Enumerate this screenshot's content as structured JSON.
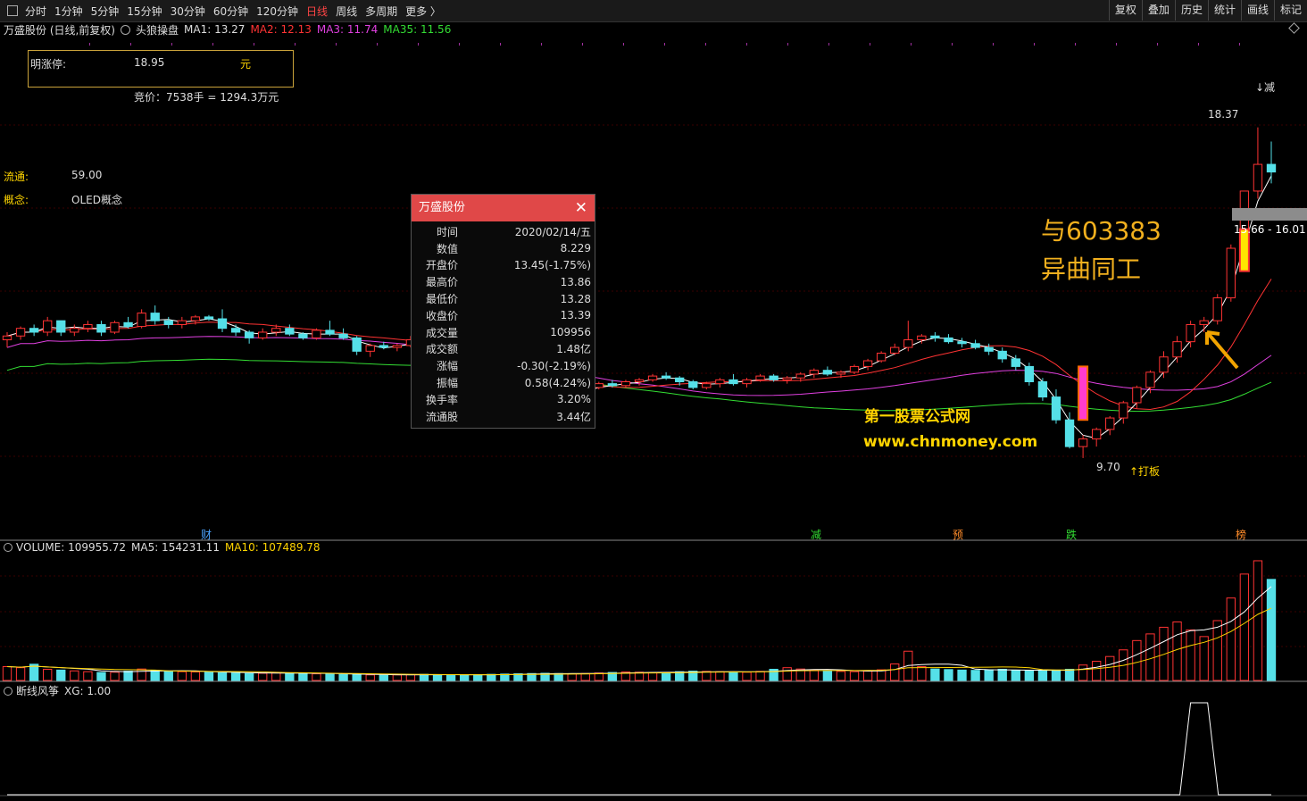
{
  "toolbar": {
    "periods": [
      "分时",
      "1分钟",
      "5分钟",
      "15分钟",
      "30分钟",
      "60分钟",
      "120分钟",
      "日线",
      "周线",
      "多周期",
      "更多 〉"
    ],
    "active_period": "日线",
    "tools": [
      "复权",
      "叠加",
      "历史",
      "统计",
      "画线",
      "标记"
    ]
  },
  "header": {
    "stock": "万盛股份 (日线,前复权)",
    "indicator": "头狼操盘",
    "ma1": "MA1: 13.27",
    "ma2": "MA2: 12.13",
    "ma3": "MA3: 11.74",
    "ma35": "MA35: 11.56",
    "colors": {
      "ma1": "#ffffff",
      "ma2": "#ff3333",
      "ma3": "#e040e0",
      "ma35": "#33dd33"
    }
  },
  "info_box": {
    "label": "明涨停:",
    "value": "18.95",
    "unit": "元"
  },
  "jingjia": "竞价：7538手 = 1294.3万元",
  "side": {
    "liutong_label": "流通:",
    "liutong_value": "59.00",
    "gainian_label": "概念:",
    "gainian_value": "OLED概念"
  },
  "popup": {
    "title": "万盛股份",
    "rows": [
      {
        "k": "时间",
        "v": "2020/02/14/五",
        "c": ""
      },
      {
        "k": "数值",
        "v": "8.229",
        "c": ""
      },
      {
        "k": "开盘价",
        "v": "13.45(-1.75%)",
        "c": "g"
      },
      {
        "k": "最高价",
        "v": "13.86",
        "c": "r"
      },
      {
        "k": "最低价",
        "v": "13.28",
        "c": "g"
      },
      {
        "k": "收盘价",
        "v": "13.39",
        "c": "g"
      },
      {
        "k": "成交量",
        "v": "109956",
        "c": ""
      },
      {
        "k": "成交额",
        "v": "1.48亿",
        "c": ""
      },
      {
        "k": "涨幅",
        "v": "-0.30(-2.19%)",
        "c": "g"
      },
      {
        "k": "振幅",
        "v": "0.58(4.24%)",
        "c": ""
      },
      {
        "k": "换手率",
        "v": "3.20%",
        "c": ""
      },
      {
        "k": "流通股",
        "v": "3.44亿",
        "c": ""
      }
    ]
  },
  "annotation": {
    "line1": "与603383",
    "line2": "异曲同工"
  },
  "watermark": {
    "line1": "第一股票公式网",
    "line2": "www.chnmoney.com"
  },
  "chart_labels": {
    "high": "18.37",
    "low": "9.70",
    "reduce": "↓减",
    "daban": "↑打板",
    "price_range": "15.66 - 16.01"
  },
  "event_markers": [
    "财",
    "减",
    "预",
    "跌",
    "榜"
  ],
  "volume_panel": {
    "vol": "VOLUME: 109955.72",
    "ma5": "MA5: 154231.11",
    "ma10": "MA10: 107489.78"
  },
  "xg_panel": {
    "title": "断线风筝",
    "xg": "XG: 1.00"
  },
  "chart_data": {
    "type": "candlestick",
    "candles": [
      [
        12.8,
        13.0,
        12.6,
        12.9
      ],
      [
        12.9,
        13.15,
        12.8,
        13.1
      ],
      [
        13.1,
        13.2,
        12.9,
        13.0
      ],
      [
        13.0,
        13.4,
        12.9,
        13.3
      ],
      [
        13.3,
        13.3,
        12.9,
        13.0
      ],
      [
        13.0,
        13.2,
        12.9,
        13.1
      ],
      [
        13.1,
        13.3,
        13.0,
        13.2
      ],
      [
        13.2,
        13.3,
        12.9,
        13.0
      ],
      [
        13.0,
        13.3,
        12.95,
        13.25
      ],
      [
        13.25,
        13.4,
        13.1,
        13.15
      ],
      [
        13.15,
        13.6,
        13.1,
        13.5
      ],
      [
        13.5,
        13.7,
        13.2,
        13.3
      ],
      [
        13.3,
        13.4,
        13.1,
        13.2
      ],
      [
        13.2,
        13.4,
        13.1,
        13.3
      ],
      [
        13.3,
        13.45,
        13.2,
        13.4
      ],
      [
        13.4,
        13.45,
        13.3,
        13.35
      ],
      [
        13.35,
        13.6,
        13.0,
        13.1
      ],
      [
        13.1,
        13.2,
        12.9,
        13.0
      ],
      [
        13.0,
        13.05,
        12.7,
        12.85
      ],
      [
        12.85,
        13.1,
        12.8,
        13.0
      ],
      [
        13.0,
        13.2,
        12.9,
        13.1
      ],
      [
        13.1,
        13.2,
        12.9,
        12.95
      ],
      [
        12.95,
        13.0,
        12.8,
        12.85
      ],
      [
        12.85,
        13.1,
        12.8,
        13.05
      ],
      [
        13.05,
        13.3,
        12.9,
        12.95
      ],
      [
        12.95,
        13.1,
        12.8,
        12.85
      ],
      [
        12.85,
        12.9,
        12.4,
        12.5
      ],
      [
        12.5,
        12.7,
        12.35,
        12.65
      ],
      [
        12.65,
        12.75,
        12.55,
        12.6
      ],
      [
        12.6,
        12.7,
        12.5,
        12.65
      ],
      [
        12.65,
        12.9,
        12.6,
        12.8
      ],
      [
        12.8,
        12.9,
        12.6,
        12.65
      ],
      [
        12.65,
        12.75,
        12.5,
        12.55
      ],
      [
        12.55,
        12.6,
        12.3,
        12.35
      ],
      [
        12.35,
        12.4,
        12.1,
        12.2
      ],
      [
        12.2,
        12.3,
        11.9,
        12.0
      ],
      [
        12.0,
        12.2,
        11.8,
        11.9
      ],
      [
        11.9,
        12.0,
        11.6,
        11.7
      ],
      [
        11.7,
        11.85,
        11.5,
        11.6
      ],
      [
        11.6,
        11.8,
        11.45,
        11.5
      ],
      [
        11.5,
        11.6,
        11.3,
        11.4
      ],
      [
        11.4,
        11.5,
        11.25,
        11.35
      ],
      [
        11.35,
        11.5,
        11.3,
        11.45
      ],
      [
        11.45,
        11.6,
        11.4,
        11.55
      ],
      [
        11.55,
        11.7,
        11.5,
        11.65
      ],
      [
        11.65,
        11.75,
        11.55,
        11.6
      ],
      [
        11.6,
        11.75,
        11.55,
        11.7
      ],
      [
        11.7,
        11.8,
        11.6,
        11.75
      ],
      [
        11.75,
        11.9,
        11.7,
        11.85
      ],
      [
        11.85,
        11.95,
        11.75,
        11.8
      ],
      [
        11.8,
        11.85,
        11.6,
        11.7
      ],
      [
        11.7,
        11.75,
        11.5,
        11.55
      ],
      [
        11.55,
        11.7,
        11.5,
        11.65
      ],
      [
        11.65,
        11.8,
        11.55,
        11.75
      ],
      [
        11.75,
        11.9,
        11.6,
        11.65
      ],
      [
        11.65,
        11.8,
        11.55,
        11.75
      ],
      [
        11.75,
        11.9,
        11.7,
        11.85
      ],
      [
        11.85,
        11.9,
        11.7,
        11.75
      ],
      [
        11.75,
        11.85,
        11.65,
        11.8
      ],
      [
        11.8,
        11.95,
        11.7,
        11.9
      ],
      [
        11.9,
        12.05,
        11.8,
        12.0
      ],
      [
        12.0,
        12.1,
        11.85,
        11.9
      ],
      [
        11.9,
        12.0,
        11.8,
        11.95
      ],
      [
        11.95,
        12.15,
        11.9,
        12.1
      ],
      [
        12.1,
        12.3,
        12.0,
        12.25
      ],
      [
        12.25,
        12.5,
        12.2,
        12.45
      ],
      [
        12.45,
        12.7,
        12.4,
        12.6
      ],
      [
        12.6,
        13.3,
        12.5,
        12.8
      ],
      [
        12.8,
        12.95,
        12.7,
        12.9
      ],
      [
        12.9,
        13.0,
        12.75,
        12.85
      ],
      [
        12.85,
        12.95,
        12.7,
        12.75
      ],
      [
        12.75,
        12.85,
        12.6,
        12.7
      ],
      [
        12.7,
        12.8,
        12.55,
        12.6
      ],
      [
        12.6,
        12.7,
        12.4,
        12.5
      ],
      [
        12.5,
        12.6,
        12.2,
        12.3
      ],
      [
        12.3,
        12.4,
        12.0,
        12.1
      ],
      [
        12.1,
        12.2,
        11.6,
        11.7
      ],
      [
        11.7,
        11.8,
        11.2,
        11.3
      ],
      [
        11.3,
        11.5,
        10.6,
        10.7
      ],
      [
        10.7,
        10.9,
        9.95,
        10.0
      ],
      [
        10.0,
        10.3,
        9.7,
        10.2
      ],
      [
        10.2,
        10.5,
        10.0,
        10.45
      ],
      [
        10.45,
        10.8,
        10.3,
        10.75
      ],
      [
        10.75,
        11.2,
        10.6,
        11.15
      ],
      [
        11.15,
        11.6,
        11.0,
        11.55
      ],
      [
        11.55,
        12.0,
        11.4,
        11.95
      ],
      [
        11.95,
        12.5,
        11.8,
        12.35
      ],
      [
        12.35,
        12.9,
        12.2,
        12.75
      ],
      [
        12.75,
        13.3,
        12.6,
        13.2
      ],
      [
        13.2,
        13.4,
        13.0,
        13.3
      ],
      [
        13.3,
        14.0,
        13.2,
        13.9
      ],
      [
        13.9,
        15.3,
        13.8,
        15.2
      ],
      [
        15.2,
        16.7,
        15.1,
        16.7
      ],
      [
        16.7,
        18.37,
        16.5,
        17.4
      ],
      [
        17.4,
        18.0,
        16.9,
        17.2
      ]
    ],
    "ma_series": [
      {
        "name": "MA1",
        "values": [
          13.27
        ]
      },
      {
        "name": "MA2",
        "values": [
          12.13
        ]
      },
      {
        "name": "MA3",
        "values": [
          11.74
        ]
      },
      {
        "name": "MA35",
        "values": [
          11.56
        ]
      }
    ],
    "volume": [
      5200,
      4800,
      6100,
      4200,
      3900,
      3600,
      3300,
      3000,
      3100,
      3500,
      4300,
      3800,
      3400,
      3300,
      3200,
      3100,
      2900,
      2800,
      2600,
      2700,
      2900,
      2800,
      2600,
      2500,
      2400,
      2300,
      2200,
      2100,
      2000,
      2100,
      2200,
      2300,
      2200,
      2100,
      2000,
      2200,
      2300,
      2400,
      2500,
      2600,
      2700,
      2600,
      2500,
      2600,
      2800,
      3000,
      3200,
      3100,
      3000,
      2900,
      3300,
      3500,
      3400,
      3300,
      3200,
      3100,
      3400,
      4200,
      4800,
      4300,
      3900,
      3600,
      3400,
      3300,
      3500,
      4000,
      6200,
      11000,
      5200,
      4300,
      4100,
      3900,
      3800,
      4000,
      4200,
      3700,
      3600,
      3800,
      3900,
      4200,
      5800,
      7200,
      9000,
      11500,
      15000,
      17500,
      20000,
      22000,
      19000,
      16500,
      22500,
      31000,
      40000,
      45000,
      38000
    ],
    "xg": {
      "signal_days": [
        88,
        89
      ],
      "value": 1.0
    }
  }
}
